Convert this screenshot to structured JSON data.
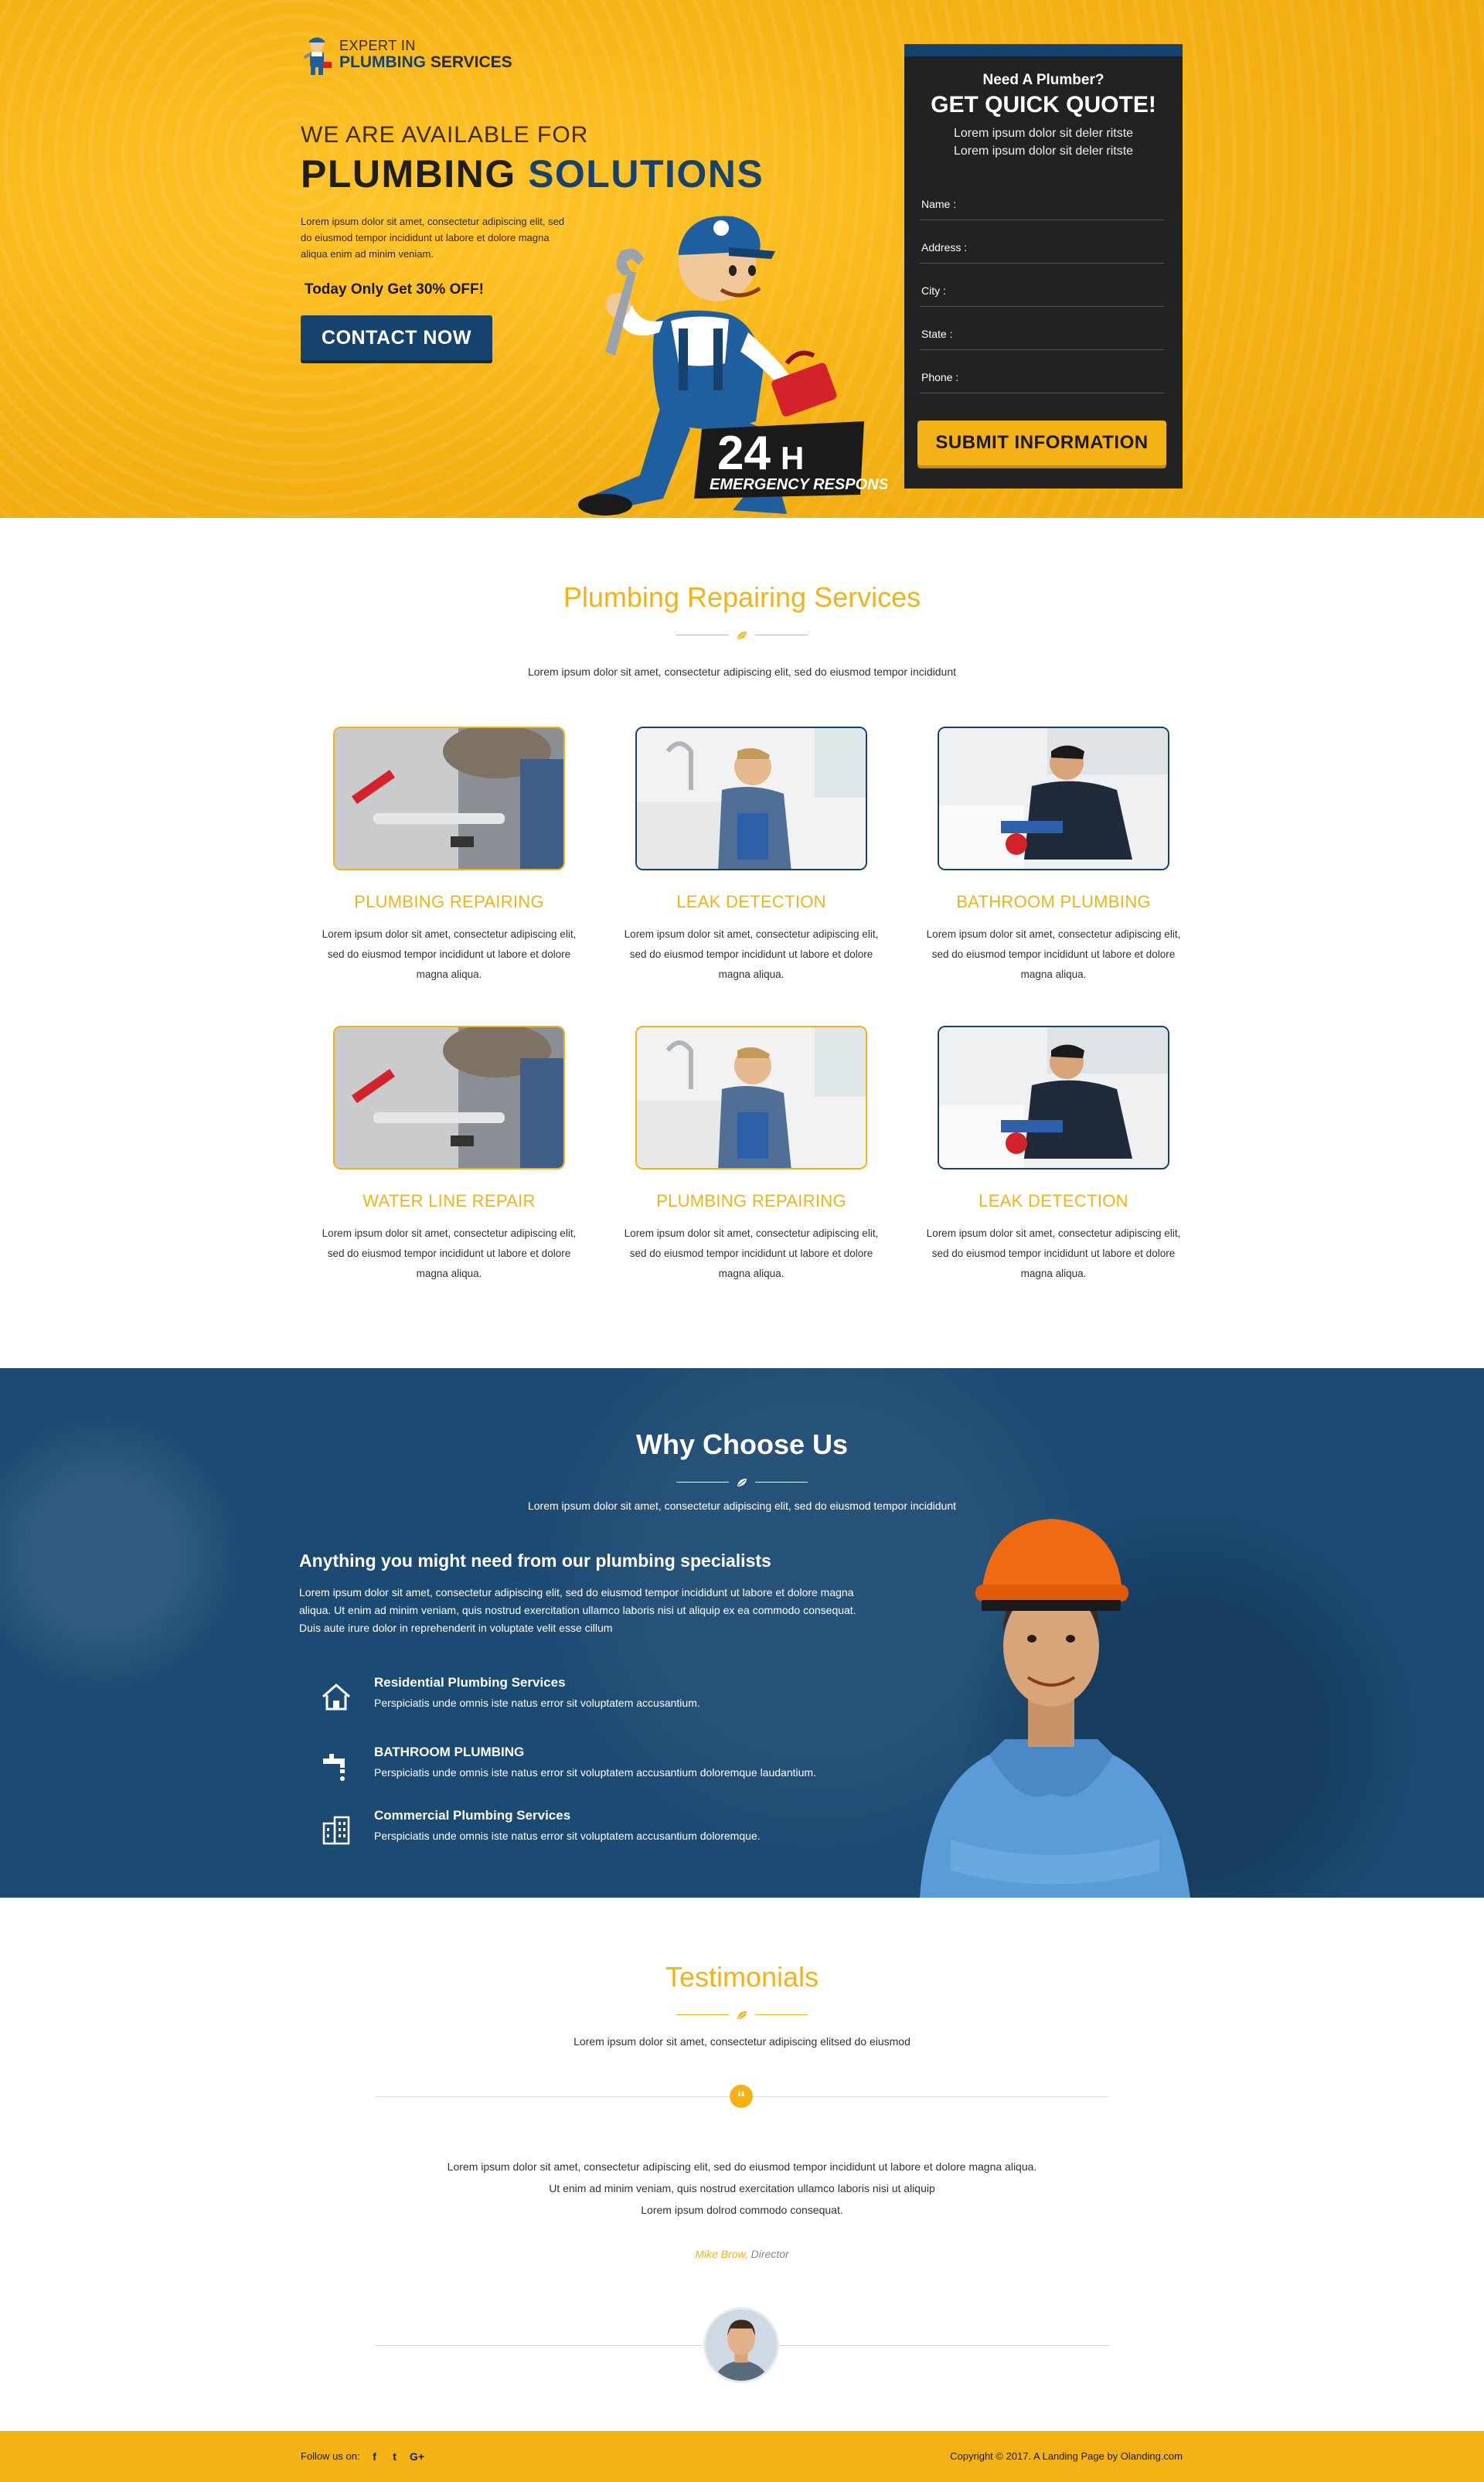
{
  "colors": {
    "accent": "#f5b216",
    "brand_blue": "#16436e",
    "dark": "#222222"
  },
  "hero": {
    "logo_top": "EXPERT IN",
    "logo_bottom_1": "PLUMBING",
    "logo_bottom_2": "SERVICES",
    "subtitle": "WE ARE AVAILABLE FOR",
    "title_1": "PLUMBING",
    "title_2": "SOLUTIONS",
    "text": "Lorem ipsum dolor sit amet, consectetur adipiscing elit, sed do eiusmod tempor incididunt ut labore et dolore magna aliqua enim ad minim veniam.",
    "offer": "Today Only Get 30% OFF!",
    "cta": "CONTACT NOW",
    "badge_big": "24",
    "badge_h": "H",
    "badge_small": "EMERGENCY RESPONSE"
  },
  "quote_form": {
    "need": "Need A Plumber?",
    "title": "GET QUICK QUOTE!",
    "text": "Lorem ipsum dolor sit deler ritste Lorem ipsum dolor sit deler ritste",
    "fields": {
      "name": "Name :",
      "address": "Address :",
      "city": "City :",
      "state": "State :",
      "phone": "Phone :"
    },
    "submit": "SUBMIT INFORMATION"
  },
  "services": {
    "title": "Plumbing Repairing Services",
    "subtitle": "Lorem ipsum dolor sit amet, consectetur adipiscing elit, sed do eiusmod tempor incididunt",
    "desc": "Lorem ipsum dolor sit amet, consectetur adipiscing elit, sed do eiusmod tempor incididunt ut labore et dolore magna aliqua.",
    "items": [
      {
        "title": "PLUMBING REPAIRING"
      },
      {
        "title": "LEAK DETECTION"
      },
      {
        "title": "BATHROOM PLUMBING"
      },
      {
        "title": "WATER LINE REPAIR"
      },
      {
        "title": "PLUMBING REPAIRING"
      },
      {
        "title": "LEAK DETECTION"
      }
    ]
  },
  "why": {
    "title": "Why Choose Us",
    "subtitle": "Lorem ipsum dolor sit amet, consectetur adipiscing elit, sed do eiusmod tempor incididunt",
    "heading": "Anything you might need from our plumbing specialists",
    "text": "Lorem ipsum dolor sit amet, consectetur adipiscing elit, sed do eiusmod tempor incididunt ut labore et dolore magna aliqua. Ut enim ad minim veniam, quis nostrud exercitation ullamco laboris nisi ut aliquip ex ea commodo consequat. Duis aute irure dolor in reprehenderit in voluptate velit esse cillum",
    "features": [
      {
        "icon": "house-icon",
        "title": "Residential Plumbing Services",
        "text": "Perspiciatis unde omnis iste natus error sit voluptatem accusantium."
      },
      {
        "icon": "faucet-icon",
        "title": "BATHROOM PLUMBING",
        "text": "Perspiciatis unde omnis iste natus error sit voluptatem accusantium doloremque laudantium."
      },
      {
        "icon": "building-icon",
        "title": "Commercial Plumbing Services",
        "text": "Perspiciatis unde omnis iste natus error sit voluptatem accusantium doloremque."
      }
    ]
  },
  "testimonials": {
    "title": "Testimonials",
    "subtitle": "Lorem ipsum dolor sit amet, consectetur adipiscing elitsed do eiusmod",
    "quote_mark": "“",
    "lines": [
      "Lorem ipsum dolor sit amet, consectetur adipiscing elit, sed do eiusmod tempor incididunt ut labore et dolore magna aliqua.",
      "Ut enim ad minim veniam, quis nostrud exercitation ullamco laboris nisi ut aliquip",
      "Lorem ipsum dolrod commodo consequat."
    ],
    "author": "Mike Brow,",
    "role": " Director"
  },
  "footer": {
    "follow": "Follow us on:",
    "social": [
      "f",
      "t",
      "G+"
    ],
    "copyright": "Copyright © 2017. A Landing Page by  Olanding.com"
  }
}
